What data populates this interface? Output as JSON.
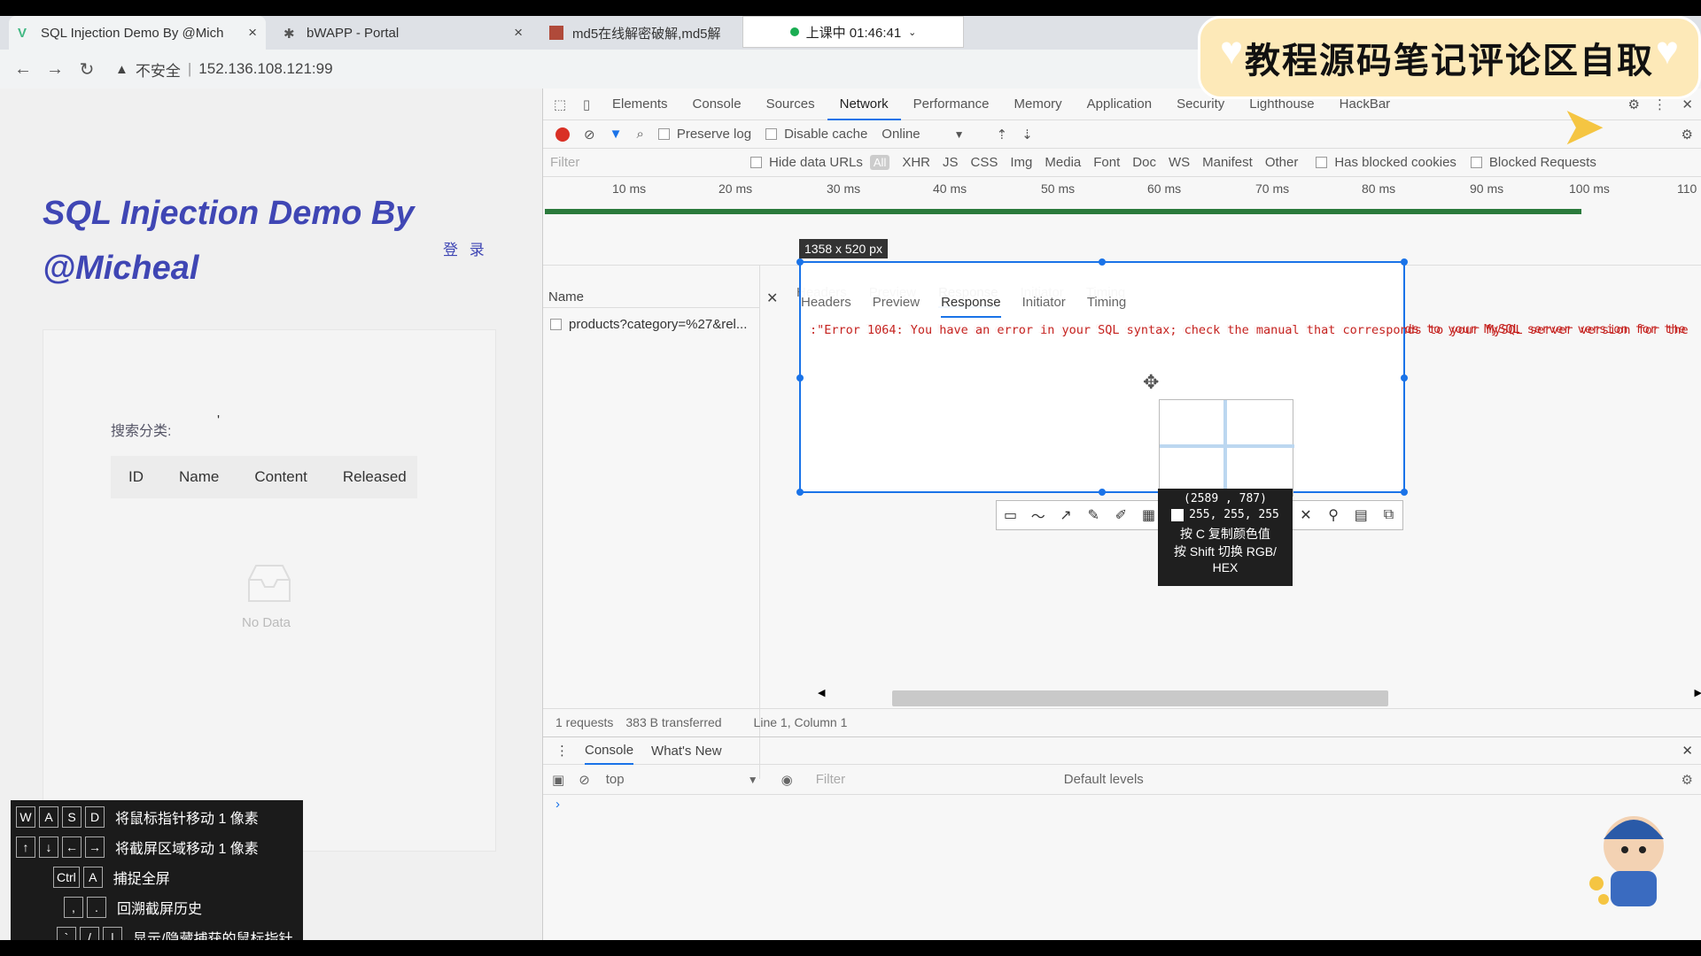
{
  "browser": {
    "tabs": [
      {
        "title": "SQL Injection Demo By @Mich"
      },
      {
        "title": "bWAPP - Portal"
      },
      {
        "title": "md5在线解密破解,md5解"
      }
    ],
    "security_label": "不安全",
    "url": "152.136.108.121:99"
  },
  "clock": {
    "text": "上课中 01:46:41"
  },
  "page": {
    "title_line1": "SQL Injection Demo By",
    "title_line2": "@Micheal",
    "login": "登 录",
    "search_label": "搜索分类:",
    "search_value": "'",
    "columns": [
      "ID",
      "Name",
      "Content",
      "Released"
    ],
    "empty": "No Data"
  },
  "devtools": {
    "tabs": [
      "Elements",
      "Console",
      "Sources",
      "Network",
      "Performance",
      "Memory",
      "Application",
      "Security",
      "Lighthouse",
      "HackBar"
    ],
    "active_tab": "Network",
    "toolbar": {
      "preserve_log": "Preserve log",
      "disable_cache": "Disable cache",
      "throttle": "Online"
    },
    "filter": {
      "placeholder": "Filter",
      "hide_data_urls": "Hide data URLs",
      "all": "All",
      "types": [
        "XHR",
        "JS",
        "CSS",
        "Img",
        "Media",
        "Font",
        "Doc",
        "WS",
        "Manifest",
        "Other"
      ],
      "blocked_cookies": "Has blocked cookies",
      "blocked_requests": "Blocked Requests"
    },
    "ticks": [
      "10 ms",
      "20 ms",
      "30 ms",
      "40 ms",
      "50 ms",
      "60 ms",
      "70 ms",
      "80 ms",
      "90 ms",
      "100 ms",
      "110"
    ],
    "list_header": "Name",
    "request": "products?category=%27&rel...",
    "detail_tabs": [
      "Headers",
      "Preview",
      "Response",
      "Initiator",
      "Timing"
    ],
    "active_detail": "Response",
    "response": ":\"Error 1064: You have an error in your SQL syntax; check the manual that corresponds to your MySQL server version for the",
    "status": {
      "requests": "1 requests",
      "transferred": "383 B transferred",
      "position": "Line 1, Column 1"
    },
    "drawer": {
      "tabs": [
        "Console",
        "What's New"
      ],
      "context": "top",
      "filter": "Filter",
      "levels": "Default levels"
    }
  },
  "screenshot_tool": {
    "size": "1358 x 520  px",
    "coords": "(2589 , 787)",
    "rgb": "255, 255, 255",
    "hint1": "按 C 复制颜色值",
    "hint2": "按 Shift 切换 RGB/",
    "hint3": "HEX"
  },
  "help": [
    {
      "keys": [
        "W",
        "A",
        "S",
        "D"
      ],
      "text": "将鼠标指针移动 1 像素"
    },
    {
      "keys": [
        "↑",
        "↓",
        "←",
        "→"
      ],
      "text": "将截屏区域移动 1 像素"
    },
    {
      "keys": [
        "Ctrl",
        "A"
      ],
      "text": "捕捉全屏"
    },
    {
      "keys": [
        ",",
        "."
      ],
      "text": "回溯截屏历史"
    },
    {
      "keys": [
        "`",
        "/",
        "|"
      ],
      "text": "显示/隐藏捕获的鼠标指针"
    }
  ],
  "banner": {
    "text": "教程源码笔记评论区自取"
  },
  "colors": {
    "accent": "#1a73e8",
    "title": "#3f46b4",
    "error": "#c5221f",
    "record": "#d93025"
  }
}
